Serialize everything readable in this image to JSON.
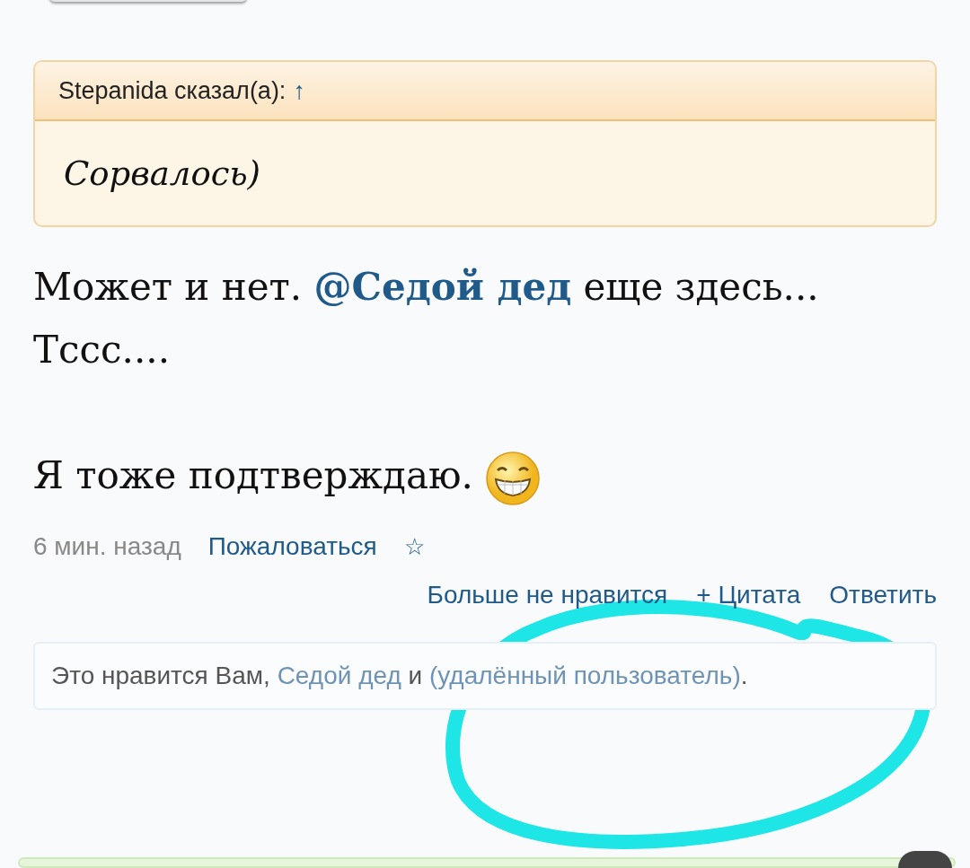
{
  "quote": {
    "author_line": "Stepanida сказал(а):",
    "jump": "↑",
    "text": "Сорвалось)"
  },
  "message": {
    "paragraphs": [
      [
        {
          "kind": "text",
          "text": "Может и нет. "
        },
        {
          "kind": "mention",
          "text": "@Седой дед"
        },
        {
          "kind": "text",
          "text": " еще здесь... Тссс...."
        }
      ],
      [
        {
          "kind": "text",
          "text": "Я тоже подтверждаю. "
        },
        {
          "kind": "smiley"
        }
      ]
    ]
  },
  "meta": {
    "time": "6 мин. назад",
    "report": "Пожаловаться",
    "bookmark": "☆"
  },
  "actions": [
    "Больше не нравится",
    "+ Цитата",
    "Ответить"
  ],
  "likes": [
    {
      "kind": "text",
      "text": "Это нравится Вам, "
    },
    {
      "kind": "link",
      "text": "Седой дед"
    },
    {
      "kind": "text",
      "text": " и "
    },
    {
      "kind": "link",
      "text": "(удалённый пользователь)"
    },
    {
      "kind": "text",
      "text": "."
    }
  ],
  "annotation": {
    "kind": "circle"
  }
}
